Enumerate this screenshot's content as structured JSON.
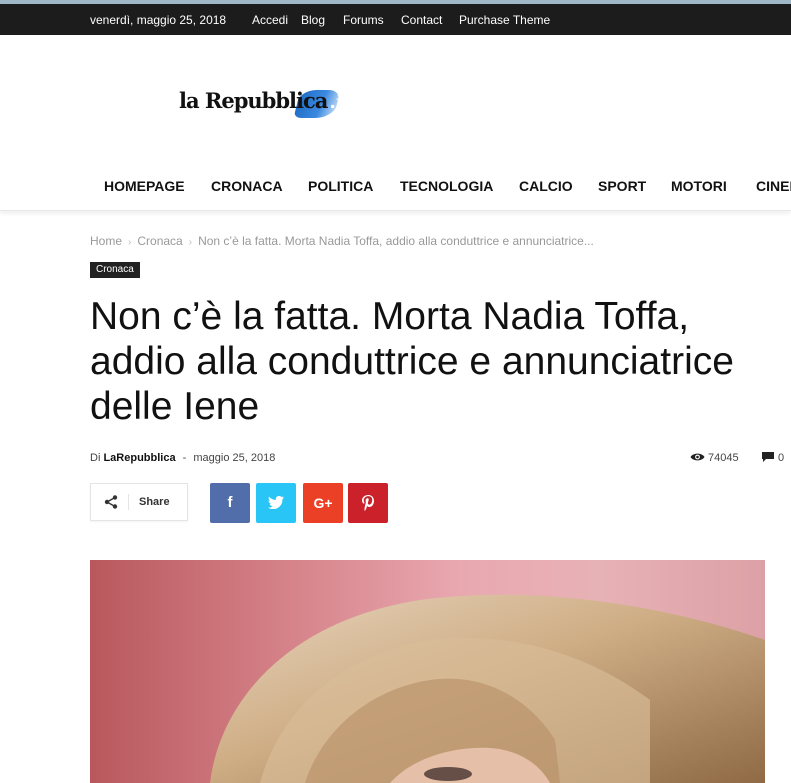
{
  "topbar": {
    "date": "venerdì, maggio 25, 2018",
    "links": [
      "Accedi",
      "Blog",
      "Forums",
      "Contact",
      "Purchase Theme"
    ]
  },
  "logo": {
    "word": "la Repubblica",
    "suffix": ".it"
  },
  "nav": {
    "items": [
      "HOMEPAGE",
      "CRONACA",
      "POLITICA",
      "TECNOLOGIA",
      "CALCIO",
      "SPORT",
      "MOTORI",
      "CINEMA"
    ]
  },
  "breadcrumb": {
    "home": "Home",
    "section": "Cronaca",
    "current": "Non c’è la fatta. Morta Nadia Toffa, addio alla conduttrice e annunciatrice..."
  },
  "category": "Cronaca",
  "article": {
    "title": "Non c’è la fatta. Morta Nadia Toffa, addio alla conduttrice e annunciatrice delle Iene",
    "by": "Di",
    "author": "LaRepubblica",
    "dash": "-",
    "date": "maggio 25, 2018",
    "views": "74045",
    "comments": "0"
  },
  "share": {
    "label": "Share",
    "buttons": [
      {
        "name": "facebook",
        "glyph": "f",
        "color": "#516eab"
      },
      {
        "name": "twitter",
        "glyph": "t",
        "color": "#29c5f6"
      },
      {
        "name": "googleplus",
        "glyph": "G+",
        "color": "#eb4026"
      },
      {
        "name": "pinterest",
        "glyph": "P",
        "color": "#ca212a"
      }
    ]
  },
  "icons": {
    "share": "share-icon",
    "views": "eye-icon",
    "comments": "comment-icon"
  }
}
